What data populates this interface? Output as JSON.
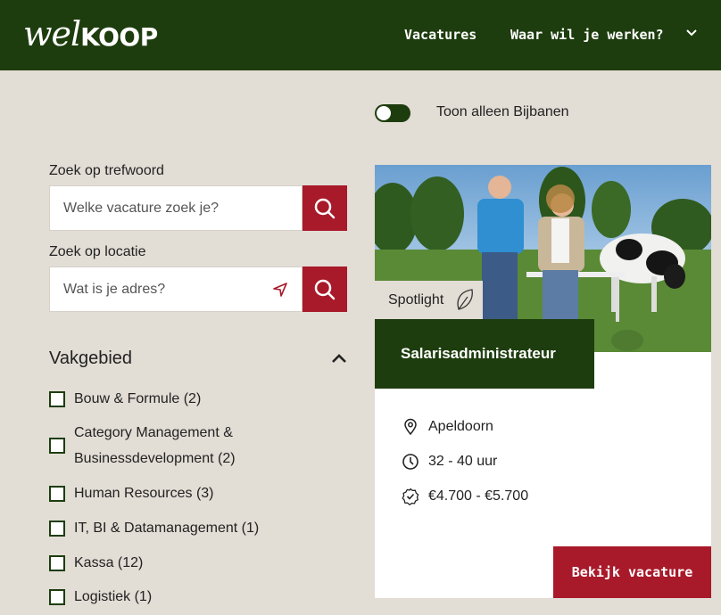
{
  "header": {
    "logo_script": "wel",
    "logo_block": "KOOP",
    "nav": {
      "vacatures": "Vacatures",
      "werken": "Waar wil je werken?"
    }
  },
  "toggle": {
    "label": "Toon alleen Bijbanen",
    "on": true
  },
  "search": {
    "keyword_label": "Zoek op trefwoord",
    "keyword_placeholder": "Welke vacature zoek je?",
    "location_label": "Zoek op locatie",
    "location_placeholder": "Wat is je adres?"
  },
  "filters": {
    "title": "Vakgebied",
    "items": [
      {
        "line1": "Bouw & Formule (2)",
        "line2": ""
      },
      {
        "line1": "Category Management &",
        "line2": "Businessdevelopment (2)"
      },
      {
        "line1": "Human Resources (3)",
        "line2": ""
      },
      {
        "line1": "IT, BI & Datamanagement (1)",
        "line2": ""
      },
      {
        "line1": "Kassa (12)",
        "line2": ""
      },
      {
        "line1": "Logistiek (1)",
        "line2": ""
      }
    ]
  },
  "card": {
    "badge": "Spotlight",
    "title": "Salarisadministrateur",
    "location": "Apeldoorn",
    "hours": "32 - 40 uur",
    "salary": "€4.700 - €5.700",
    "cta": "Bekijk vacature"
  },
  "colors": {
    "brand_green": "#1e3d0e",
    "brand_red": "#a8192a",
    "background": "#e2ddd5"
  },
  "icons": [
    "search-icon",
    "location-arrow-icon",
    "chevron-down-icon",
    "chevron-up-icon",
    "leaf-icon",
    "map-pin-icon",
    "clock-icon",
    "badge-check-icon"
  ]
}
